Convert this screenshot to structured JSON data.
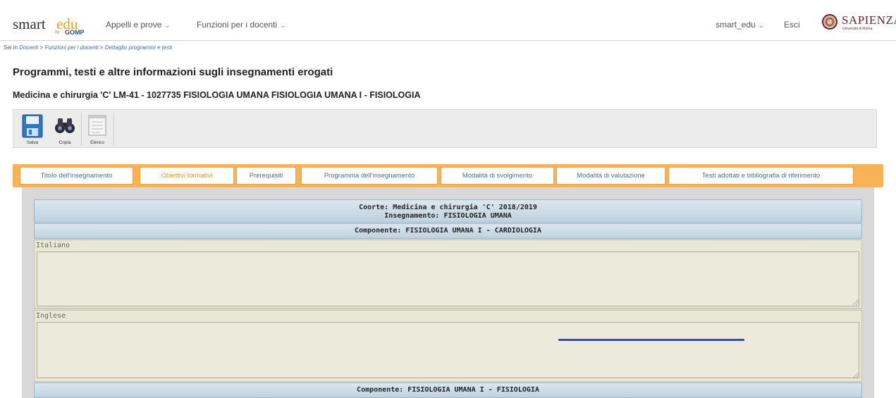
{
  "header": {
    "logo": {
      "smart": "smart",
      "edu": "edu",
      "by": "by",
      "gomp": "GOMP"
    },
    "menus": [
      {
        "label": "Appelli e prove"
      },
      {
        "label": "Funzioni per i docenti"
      }
    ],
    "user_menu": "smart_edu",
    "logout": "Esci",
    "university": {
      "name": "SAPIENZA",
      "subtitle": "Università di Roma"
    }
  },
  "breadcrumb": {
    "prefix": "Sei in",
    "items": [
      "Docenti",
      "Funzioni per i docenti",
      "Dettaglio programmi e testi"
    ],
    "separator": ">"
  },
  "page": {
    "title": "Programmi, testi e altre informazioni sugli insegnamenti erogati",
    "subtitle": "Medicina e chirurgia 'C' LM-41 - 1027735 FISIOLOGIA UMANA FISIOLOGIA UMANA I - FISIOLOGIA"
  },
  "toolbar": {
    "items": [
      {
        "label": "Salva",
        "icon": "save-icon"
      },
      {
        "label": "Copia",
        "icon": "binoculars-icon"
      },
      {
        "label": "Elenco",
        "icon": "list-icon"
      }
    ]
  },
  "tabs": [
    {
      "label": "Titolo dell'insegnamento",
      "active": false
    },
    {
      "label": "Obiettivi formativi",
      "active": true
    },
    {
      "label": "Prerequisiti",
      "active": false
    },
    {
      "label": "Programma dell'insegnamento",
      "active": false
    },
    {
      "label": "Modalità di svolgimento",
      "active": false
    },
    {
      "label": "Modalità di valutazione",
      "active": false
    },
    {
      "label": "Testi adottati e bibliografia di riferimento",
      "active": false
    }
  ],
  "content": {
    "coorte": "Coorte: Medicina e chirurgia 'C' 2018/2019",
    "insegnamento": "Insegnamento: FISIOLOGIA UMANA",
    "componente_1": "Componente: FISIOLOGIA UMANA I - CARDIOLOGIA",
    "fields": [
      {
        "label": "Italiano",
        "value": ""
      },
      {
        "label": "Inglese",
        "value": ""
      }
    ],
    "componente_2": "Componente: FISIOLOGIA UMANA I - FISIOLOGIA"
  },
  "colors": {
    "tab_bar": "#f7b356",
    "tab_active_text": "#f0962a",
    "tab_text": "#4a6c9b",
    "section_header": "#c9dae5",
    "field_bg": "#e9e8d6",
    "brand_orange": "#f39a1e",
    "brand_sapienza": "#6b1f2a"
  }
}
